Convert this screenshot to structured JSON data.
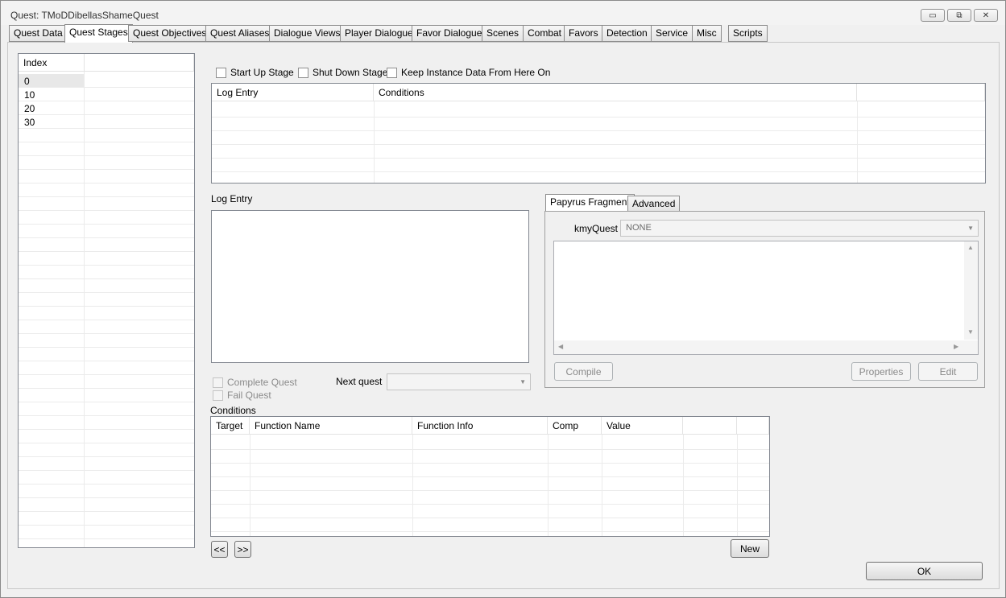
{
  "window": {
    "title": "Quest: TMoDDibellasShameQuest",
    "minimize_glyph": "▭",
    "maximize_glyph": "⧉",
    "close_glyph": "✕"
  },
  "tabs": [
    {
      "label": "Quest Data"
    },
    {
      "label": "Quest Stages"
    },
    {
      "label": "Quest Objectives"
    },
    {
      "label": "Quest Aliases"
    },
    {
      "label": "Dialogue Views"
    },
    {
      "label": "Player Dialogue"
    },
    {
      "label": "Favor Dialogue"
    },
    {
      "label": "Scenes"
    },
    {
      "label": "Combat"
    },
    {
      "label": "Favors"
    },
    {
      "label": "Detection"
    },
    {
      "label": "Service"
    },
    {
      "label": "Misc"
    },
    {
      "label": "Scripts"
    }
  ],
  "active_tab": "Quest Stages",
  "stages": {
    "header": "Index",
    "rows": [
      "0",
      "10",
      "20",
      "30"
    ]
  },
  "stage_flags": {
    "start_up": "Start Up Stage",
    "shut_down": "Shut Down Stage",
    "keep_instance": "Keep Instance Data From Here On"
  },
  "log_table": {
    "headers": [
      "Log Entry",
      "Conditions"
    ]
  },
  "log_entry": {
    "label": "Log Entry",
    "value": ""
  },
  "quest_flags": {
    "complete": "Complete Quest",
    "fail": "Fail Quest"
  },
  "next_quest": {
    "label": "Next quest",
    "value": ""
  },
  "fragment": {
    "tabs": [
      "Papyrus Fragment",
      "Advanced"
    ],
    "property_label": "kmyQuest",
    "property_value": "NONE",
    "compile": "Compile",
    "properties": "Properties",
    "edit": "Edit"
  },
  "conditions": {
    "label": "Conditions",
    "headers": [
      "Target",
      "Function Name",
      "Function Info",
      "Comp",
      "Value"
    ],
    "prev": "<<",
    "next": ">>",
    "new": "New"
  },
  "ok": "OK"
}
